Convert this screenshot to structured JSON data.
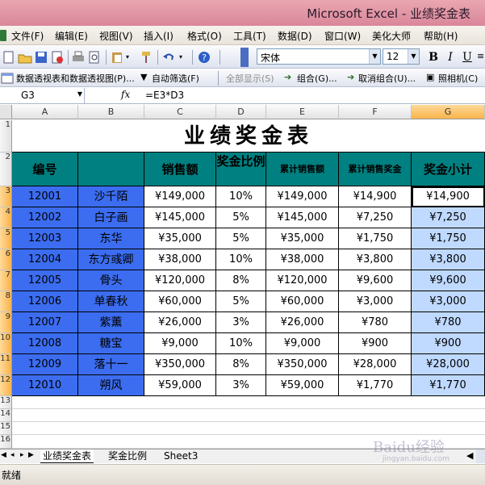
{
  "window": {
    "title": "Microsoft Excel - 业绩奖金表"
  },
  "menu": [
    "文件(F)",
    "编辑(E)",
    "视图(V)",
    "插入(I)",
    "格式(O)",
    "工具(T)",
    "数据(D)",
    "窗口(W)",
    "美化大师",
    "帮助(H)"
  ],
  "toolbar": {
    "font_name": "宋体",
    "font_size": "12",
    "bold": "B",
    "italic": "I",
    "underline": "U",
    "pivot_label": "数据透视表和数据透视图(P)...",
    "autofilter_label": "自动筛选(F)",
    "show_all_label": "全部显示(S)",
    "group_label": "组合(G)...",
    "ungroup_label": "取消组合(U)...",
    "camera_label": "照相机(C)"
  },
  "formula_bar": {
    "name_box": "G3",
    "fx": "fx",
    "formula": "=E3*D3"
  },
  "columns": [
    "A",
    "B",
    "C",
    "D",
    "E",
    "F",
    "G"
  ],
  "row_headers": [
    "1",
    "2",
    "3",
    "4",
    "5",
    "6",
    "7",
    "8",
    "9",
    "10",
    "11",
    "12",
    "13",
    "14",
    "15",
    "16"
  ],
  "sheet": {
    "title": "业绩奖金表",
    "headers": [
      "编号",
      "",
      "销售额",
      "奖金比例",
      "累计销售额",
      "累计销售奖金",
      "奖金小计"
    ],
    "rows": [
      [
        "12001",
        "沙千陌",
        "¥149,000",
        "10%",
        "¥149,000",
        "¥14,900",
        "¥14,900"
      ],
      [
        "12002",
        "白子画",
        "¥145,000",
        "5%",
        "¥145,000",
        "¥7,250",
        "¥7,250"
      ],
      [
        "12003",
        "东华",
        "¥35,000",
        "5%",
        "¥35,000",
        "¥1,750",
        "¥1,750"
      ],
      [
        "12004",
        "东方彧卿",
        "¥38,000",
        "10%",
        "¥38,000",
        "¥3,800",
        "¥3,800"
      ],
      [
        "12005",
        "骨头",
        "¥120,000",
        "8%",
        "¥120,000",
        "¥9,600",
        "¥9,600"
      ],
      [
        "12006",
        "单春秋",
        "¥60,000",
        "5%",
        "¥60,000",
        "¥3,000",
        "¥3,000"
      ],
      [
        "12007",
        "紫薰",
        "¥26,000",
        "3%",
        "¥26,000",
        "¥780",
        "¥780"
      ],
      [
        "12008",
        "糖宝",
        "¥9,000",
        "10%",
        "¥9,000",
        "¥900",
        "¥900"
      ],
      [
        "12009",
        "落十一",
        "¥350,000",
        "8%",
        "¥350,000",
        "¥28,000",
        "¥28,000"
      ],
      [
        "12010",
        "朔风",
        "¥59,000",
        "3%",
        "¥59,000",
        "¥1,770",
        "¥1,770"
      ]
    ]
  },
  "tabs": [
    "业绩奖金表",
    "奖金比例",
    "Sheet3"
  ],
  "status": "就绪",
  "watermark": {
    "main": "Baidu经验",
    "sub": "jingyan.baidu.com"
  },
  "colors": {
    "header_teal": "#008080",
    "id_blue": "#3c6df0",
    "selected_fill": "#bfd9ff"
  }
}
